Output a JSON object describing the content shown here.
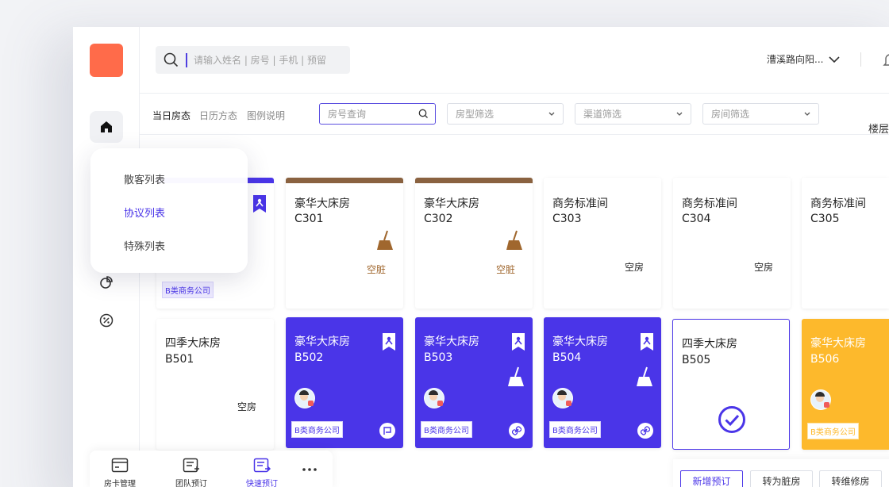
{
  "search": {
    "placeholder": "请输入姓名 | 房号 | 手机 | 预留"
  },
  "header": {
    "hotel": "漕溪路向阳..."
  },
  "view_tabs": [
    "当日房态",
    "日历方态",
    "图例说明"
  ],
  "filters": {
    "room_query": "房号查询",
    "room_type": "房型筛选",
    "channel": "渠道筛选",
    "room": "房间筛选"
  },
  "floor_label": "楼层",
  "dropdown": {
    "items": [
      "散客列表",
      "协议列表",
      "特殊列表"
    ],
    "active": "协议列表"
  },
  "rooms_row1": [
    {
      "type": "豪华大床房",
      "number": "C301",
      "status": "空脏"
    },
    {
      "type": "豪华大床房",
      "number": "C302",
      "status": "空脏"
    },
    {
      "type": "商务标准间",
      "number": "C303",
      "status": "空房"
    },
    {
      "type": "商务标准间",
      "number": "C304",
      "status": "空房"
    },
    {
      "type": "商务标准间",
      "number": "C305",
      "status": ""
    }
  ],
  "first_card_tag": "B类商务公司",
  "rooms_row2": [
    {
      "type": "四季大床房",
      "number": "B501",
      "status": "空房",
      "tag": ""
    },
    {
      "type": "豪华大床房",
      "number": "B502",
      "status": "",
      "tag": "B类商务公司"
    },
    {
      "type": "豪华大床房",
      "number": "B503",
      "status": "",
      "tag": "B类商务公司"
    },
    {
      "type": "豪华大床房",
      "number": "B504",
      "status": "",
      "tag": "B类商务公司"
    },
    {
      "type": "四季大床房",
      "number": "B505",
      "status": "",
      "tag": ""
    },
    {
      "type": "豪华大床房",
      "number": "B506",
      "status": "",
      "tag": "B类商务公司"
    }
  ],
  "bottom_nav": [
    "房卡管理",
    "团队预订",
    "快速预订"
  ],
  "actions": [
    "新增预订",
    "转为脏房",
    "转维修房"
  ],
  "colors": {
    "accent": "#4a35e8",
    "logo": "#ff6b4a",
    "dirty_bar": "#8a6240",
    "yellow": "#fdb92c"
  }
}
